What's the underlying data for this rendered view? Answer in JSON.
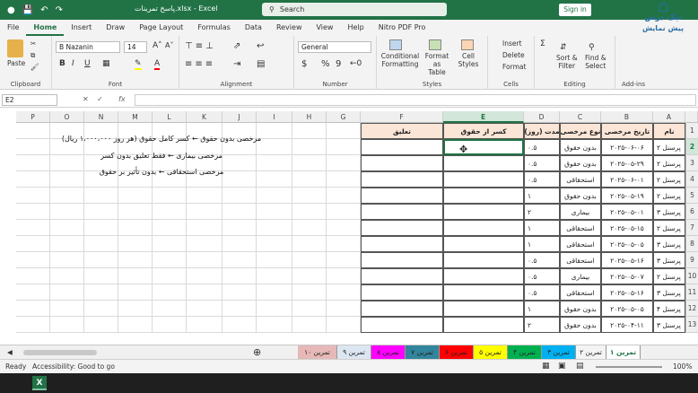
{
  "window": {
    "title": "پاسخ تمرینات.xlsx - Excel",
    "search_label": "Search",
    "signin_label": "Sign in"
  },
  "menu_tabs": [
    "File",
    "Home",
    "Insert",
    "Draw",
    "Page Layout",
    "Formulas",
    "Data",
    "Review",
    "View",
    "Help",
    "Nitro PDF Pro"
  ],
  "ribbon": {
    "clipboard": {
      "paste": "Paste",
      "label": "Clipboard"
    },
    "font": {
      "name": "B Nazanin",
      "size": "14",
      "label": "Font"
    },
    "alignment": {
      "label": "Alignment"
    },
    "number": {
      "format": "General",
      "label": "Number"
    },
    "styles": {
      "conditional": "Conditional",
      "conditional2": "Formatting",
      "table": "Format as",
      "table2": "Table",
      "cell": "Cell",
      "cell2": "Styles",
      "label": "Styles"
    },
    "cells": {
      "insert": "Insert",
      "delete": "Delete",
      "format": "Format",
      "label": "Cells"
    },
    "editing": {
      "sort": "Sort &",
      "sort2": "Filter",
      "find": "Find &",
      "find2": "Select",
      "label": "Editing"
    },
    "addins": {
      "label": "Add-ins"
    }
  },
  "formula_bar": {
    "name_box": "E2",
    "fx": "fx",
    "content": ""
  },
  "columns": [
    "A",
    "B",
    "C",
    "D",
    "E",
    "F",
    "G",
    "H",
    "I",
    "J",
    "K",
    "L",
    "M",
    "N",
    "O",
    "P"
  ],
  "rows": [
    "1",
    "2",
    "3",
    "4",
    "5",
    "6",
    "7",
    "8",
    "9",
    "10",
    "11",
    "12",
    "13"
  ],
  "table_headers": {
    "A": "نام",
    "B": "تاریخ مرخصی",
    "C": "نوع مرخصی",
    "D": "مدت (روز)",
    "E": "کسر از حقوق",
    "F": "تعلیق"
  },
  "table_rows": [
    {
      "name": "پرسنل ۲",
      "date": "۲۰۲۵-۰۶-۰۶",
      "type": "بدون حقوق",
      "days": "۰.۵"
    },
    {
      "name": "پرسنل ۲",
      "date": "۲۰۲۵-۰۵-۲۹",
      "type": "بدون حقوق",
      "days": "۰.۵"
    },
    {
      "name": "پرسنل ۲",
      "date": "۲۰۲۵-۰۶-۰۱",
      "type": "استحقاقی",
      "days": "۰.۵"
    },
    {
      "name": "پرسنل ۲",
      "date": "۲۰۲۵-۰۵-۱۹",
      "type": "بدون حقوق",
      "days": "۱"
    },
    {
      "name": "پرسنل ۳",
      "date": "۲۰۲۵-۰۵-۰۱",
      "type": "بیماری",
      "days": "۲"
    },
    {
      "name": "پرسنل ۲",
      "date": "۲۰۲۵-۰۵-۱۵",
      "type": "استحقاقی",
      "days": "۱"
    },
    {
      "name": "پرسنل ۳",
      "date": "۲۰۲۵-۰۵-۰۵",
      "type": "استحقاقی",
      "days": "۱"
    },
    {
      "name": "پرسنل ۳",
      "date": "۲۰۲۵-۰۵-۱۶",
      "type": "استحقاقی",
      "days": "۰.۵"
    },
    {
      "name": "پرسنل ۲",
      "date": "۲۰۲۵-۰۵-۰۷",
      "type": "بیماری",
      "days": "۰.۵"
    },
    {
      "name": "پرسنل ۳",
      "date": "۲۰۲۵-۰۵-۱۶",
      "type": "استحقاقی",
      "days": "۰.۵"
    },
    {
      "name": "پرسنل ۴",
      "date": "۲۰۲۵-۰۵-۰۵",
      "type": "بدون حقوق",
      "days": "۱"
    },
    {
      "name": "پرسنل ۳",
      "date": "۲۰۲۵-۰۴-۱۱",
      "type": "بدون حقوق",
      "days": "۲"
    }
  ],
  "notes": [
    "مرخصی بدون حقوق ← کسر کامل حقوق (هر روز ۱،۰۰۰،۰۰۰ ریال)",
    "مرخصی بیماری ← فقط تعلیق بدون کسر",
    "مرخصی استحقاقی ← بدون تأثیر بر حقوق"
  ],
  "sheet_tabs": [
    {
      "label": "تمرین ۱",
      "color": "#ffffff"
    },
    {
      "label": "تمرین ۲",
      "color": "#f4f4f4"
    },
    {
      "label": "تمرین ۳",
      "color": "#00b0f0"
    },
    {
      "label": "تمرین ۴",
      "color": "#00b050"
    },
    {
      "label": "تمرین ۵",
      "color": "#ffff00"
    },
    {
      "label": "تمرین ۶",
      "color": "#ff0000"
    },
    {
      "label": "تمرین ۷",
      "color": "#31859c"
    },
    {
      "label": "تمرین ۸",
      "color": "#ff00ff"
    },
    {
      "label": "تمرین ۹",
      "color": "#dce6f1"
    },
    {
      "label": "تمرین ۱۰",
      "color": "#e6b8b7"
    }
  ],
  "status": {
    "ready": "Ready",
    "accessibility": "Accessibility: Good to go",
    "zoom": "100%"
  },
  "logo": {
    "line1": "نیک درس",
    "line2": "پیش نمایش"
  },
  "colors": {
    "accent": "#217346",
    "header_fill": "#fbe5d6"
  }
}
